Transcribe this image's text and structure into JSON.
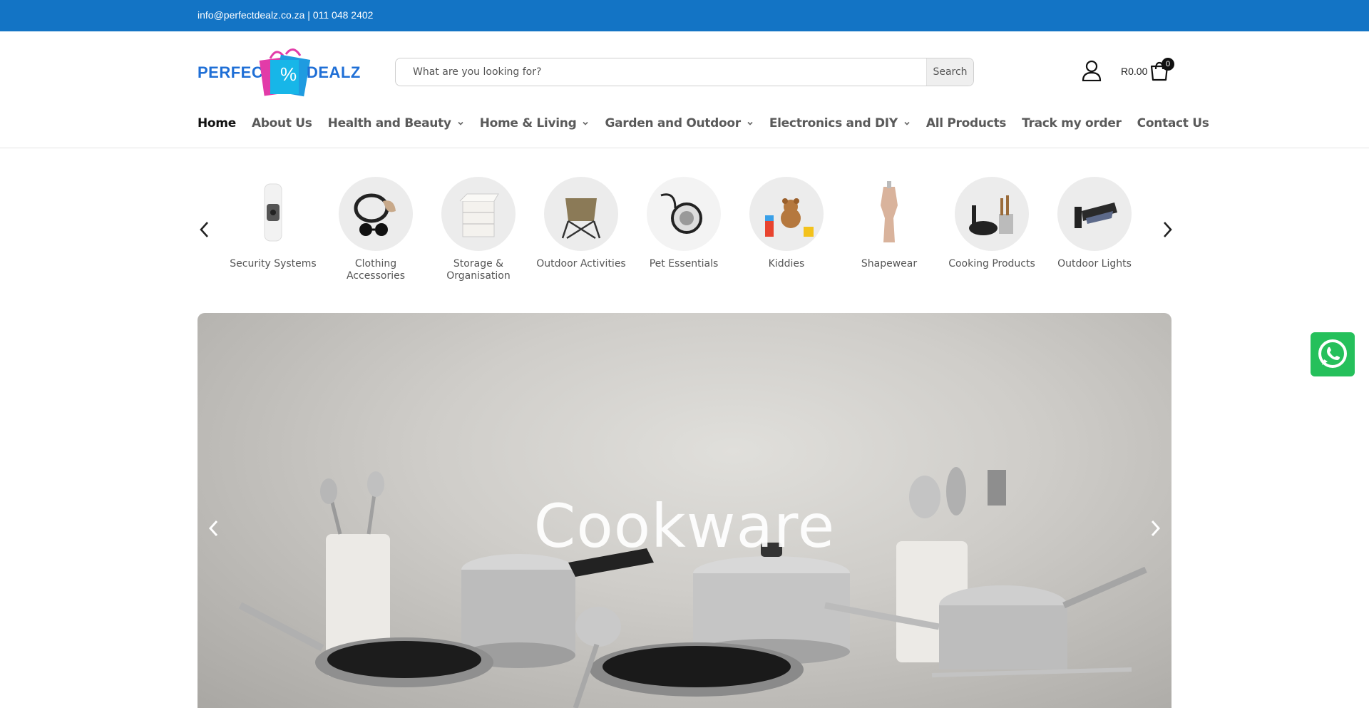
{
  "topbar": {
    "contact": "info@perfectdealz.co.za | 011 048 2402"
  },
  "logo": {
    "left": "PERFECT",
    "right": "DEALZ",
    "mark": "%"
  },
  "search": {
    "placeholder": "What are you looking for?",
    "button": "Search"
  },
  "cart": {
    "total": "R0.00",
    "count": "0"
  },
  "nav": {
    "items": [
      {
        "label": "Home",
        "active": true,
        "dropdown": false
      },
      {
        "label": "About Us",
        "dropdown": false
      },
      {
        "label": "Health and Beauty",
        "dropdown": true
      },
      {
        "label": "Home & Living",
        "dropdown": true
      },
      {
        "label": "Garden and Outdoor",
        "dropdown": true
      },
      {
        "label": "Electronics and DIY",
        "dropdown": true
      },
      {
        "label": "All Products",
        "dropdown": false
      },
      {
        "label": "Track my order",
        "dropdown": false
      },
      {
        "label": "Contact Us",
        "dropdown": false
      }
    ]
  },
  "categories": [
    {
      "label": "Security Systems",
      "icon": "security-camera"
    },
    {
      "label": "Clothing Accessories",
      "icon": "sunglasses-scarf"
    },
    {
      "label": "Storage & Organisation",
      "icon": "storage-drawers"
    },
    {
      "label": "Outdoor Activities",
      "icon": "camping-chair"
    },
    {
      "label": "Pet Essentials",
      "icon": "pet-leash-bowl"
    },
    {
      "label": "Kiddies",
      "icon": "teddy-toys"
    },
    {
      "label": "Shapewear",
      "icon": "mannequin"
    },
    {
      "label": "Cooking Products",
      "icon": "pans-utensils"
    },
    {
      "label": "Outdoor Lights",
      "icon": "wall-light"
    }
  ],
  "hero": {
    "title": "Cookware"
  },
  "colors": {
    "topbar": "#1374c5",
    "whatsapp": "#25c05b"
  }
}
